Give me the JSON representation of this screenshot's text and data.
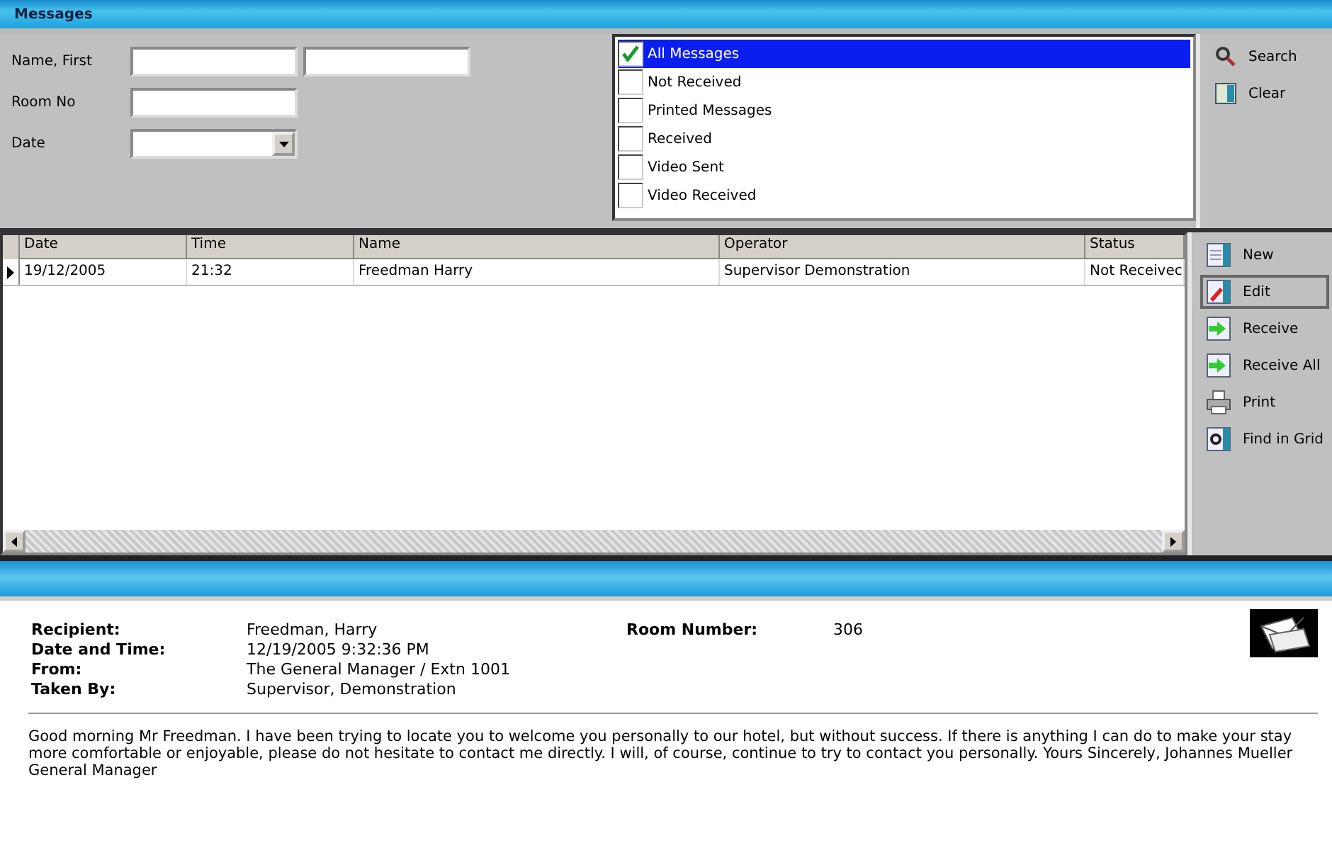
{
  "window": {
    "title": "Messages"
  },
  "filter": {
    "fields": [
      {
        "label": "Name, First",
        "kind": "pair"
      },
      {
        "label": "Room No",
        "kind": "text"
      },
      {
        "label": "Date",
        "kind": "dropdown"
      }
    ],
    "options": [
      {
        "label": "All Messages",
        "checked": true,
        "selected": true
      },
      {
        "label": "Not Received",
        "checked": false,
        "selected": false
      },
      {
        "label": "Printed Messages",
        "checked": false,
        "selected": false
      },
      {
        "label": "Received",
        "checked": false,
        "selected": false
      },
      {
        "label": "Video Sent",
        "checked": false,
        "selected": false
      },
      {
        "label": "Video Received",
        "checked": false,
        "selected": false
      }
    ],
    "buttons": [
      {
        "label": "Search",
        "kind": "search"
      },
      {
        "label": "Clear",
        "kind": "clear"
      }
    ]
  },
  "table": {
    "columns": [
      "Date",
      "Time",
      "Name",
      "Operator",
      "Status"
    ],
    "rows": [
      {
        "cells": [
          "19/12/2005",
          "21:32",
          "Freedman Harry",
          "Supervisor Demonstration",
          "Not Receivec"
        ],
        "selected": true
      }
    ]
  },
  "actions": [
    {
      "label": "New",
      "kind": "new",
      "selected": false
    },
    {
      "label": "Edit",
      "kind": "edit",
      "selected": true
    },
    {
      "label": "Receive",
      "kind": "receive",
      "selected": false
    },
    {
      "label": "Receive All",
      "kind": "receive",
      "selected": false
    },
    {
      "label": "Print",
      "kind": "print",
      "selected": false
    },
    {
      "label": "Find in Grid",
      "kind": "find",
      "selected": false
    }
  ],
  "detail": {
    "fields": [
      {
        "label": "Recipient:",
        "value": "Freedman, Harry"
      },
      {
        "label": "Date and Time:",
        "value": "12/19/2005 9:32:36 PM"
      },
      {
        "label": "From:",
        "value": "The General Manager / Extn 1001"
      },
      {
        "label": "Taken By:",
        "value": "Supervisor, Demonstration"
      }
    ],
    "room": {
      "label": "Room Number:",
      "value": "306"
    },
    "message": "Good morning Mr Freedman. I have been trying to locate you to welcome you personally to our hotel, but without success. If there is anything I can do to make your stay more comfortable or enjoyable, please do not hesitate to contact me directly. I will, of course, continue to try to contact you personally. Yours Sincerely, Johannes Mueller General Manager"
  }
}
